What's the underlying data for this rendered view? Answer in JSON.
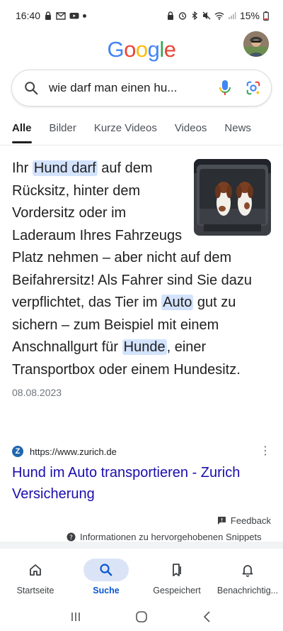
{
  "status_bar": {
    "time": "16:40",
    "battery": "15%",
    "left_icons": [
      "lock-icon",
      "gmail-icon",
      "youtube-icon",
      "dot-icon"
    ],
    "right_icons": [
      "lock-icon",
      "alarm-icon",
      "bluetooth-icon",
      "mute-icon",
      "wifi-icon",
      "signal-icon",
      "battery-icon"
    ]
  },
  "header": {
    "logo_letters": [
      {
        "char": "G",
        "color": "#4285F4"
      },
      {
        "char": "o",
        "color": "#EA4335"
      },
      {
        "char": "o",
        "color": "#FBBC05"
      },
      {
        "char": "g",
        "color": "#4285F4"
      },
      {
        "char": "l",
        "color": "#34A853"
      },
      {
        "char": "e",
        "color": "#EA4335"
      }
    ]
  },
  "search": {
    "query": "wie darf man einen hu..."
  },
  "tabs": [
    {
      "label": "Alle",
      "active": true
    },
    {
      "label": "Bilder",
      "active": false
    },
    {
      "label": "Kurze Videos",
      "active": false
    },
    {
      "label": "Videos",
      "active": false
    },
    {
      "label": "News",
      "active": false
    }
  ],
  "snippet": {
    "parts": [
      {
        "text": "Ihr ",
        "hl": false
      },
      {
        "text": "Hund darf",
        "hl": true
      },
      {
        "text": " auf dem Rücksitz, hinter dem Vordersitz oder im Laderaum Ihres Fahrzeugs Platz nehmen – aber nicht auf dem Beifahrersitz! Als Fahrer sind Sie dazu verpflichtet, das Tier im ",
        "hl": false
      },
      {
        "text": "Auto",
        "hl": true
      },
      {
        "text": " gut zu sichern – zum Beispiel mit einem Anschnallgurt für ",
        "hl": false
      },
      {
        "text": "Hunde",
        "hl": true
      },
      {
        "text": ", einer Transportbox oder einem Hundesitz.",
        "hl": false
      }
    ],
    "date": "08.08.2023"
  },
  "result": {
    "favicon_letter": "Z",
    "url": "https://www.zurich.de",
    "title": "Hund im Auto transportieren - Zurich Versicherung"
  },
  "feedback": {
    "label": "Feedback",
    "info": "Informationen zu hervorgehobenen Snippets"
  },
  "bottom_nav": [
    {
      "label": "Startseite",
      "icon": "home-icon",
      "active": false
    },
    {
      "label": "Suche",
      "icon": "search-icon",
      "active": true
    },
    {
      "label": "Gespeichert",
      "icon": "bookmark-icon",
      "active": false
    },
    {
      "label": "Benachrichtig...",
      "icon": "bell-icon",
      "active": false
    }
  ],
  "colors": {
    "highlight": "#d3e3fd",
    "link": "#1a0dab",
    "active_nav": "#0b57d0"
  }
}
